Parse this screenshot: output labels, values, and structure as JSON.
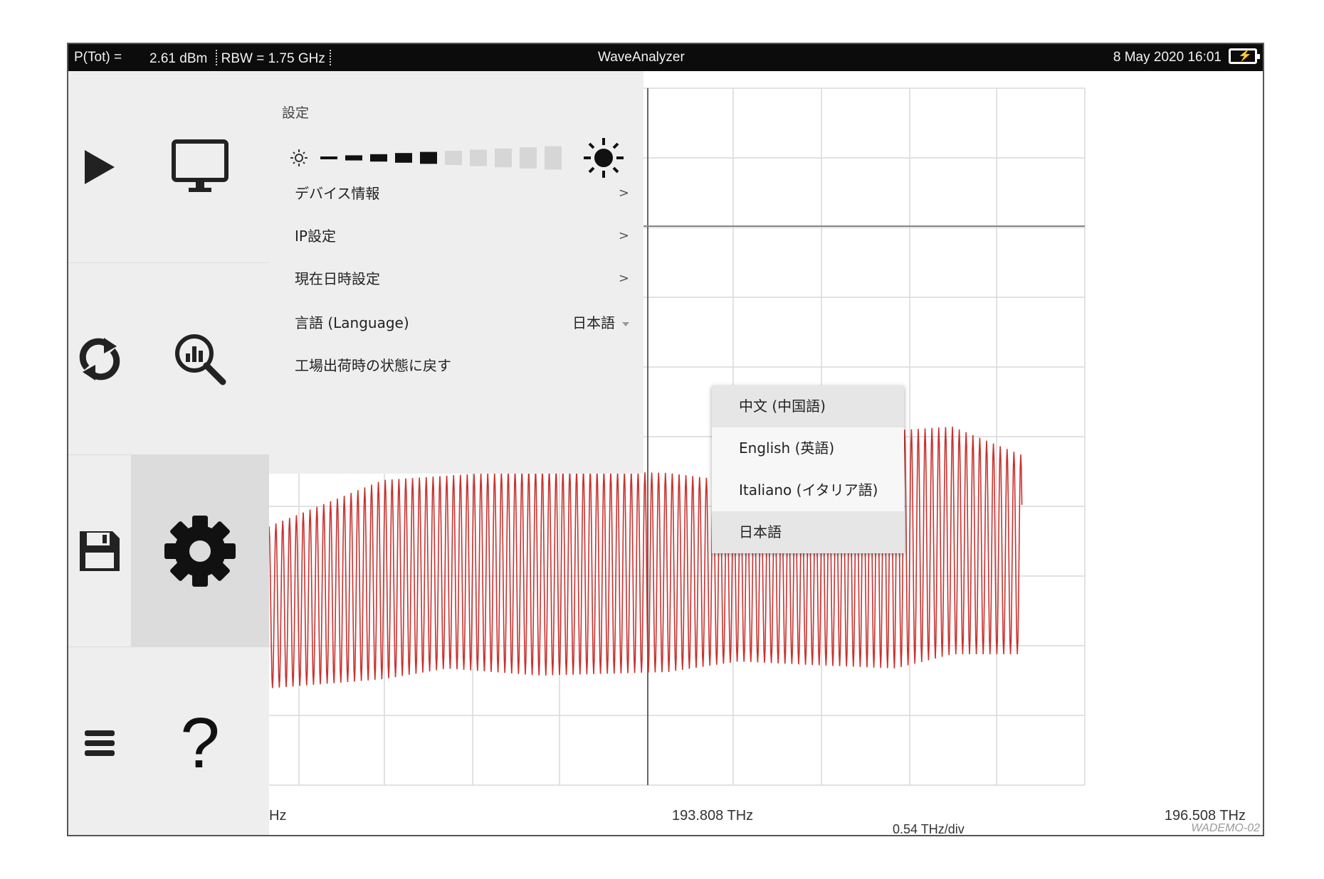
{
  "statusbar": {
    "power_label": "P(Tot) =",
    "power_value": "2.61 dBm",
    "rbw": "RBW = 1.75 GHz",
    "app_title": "WaveAnalyzer",
    "datetime": "8 May 2020 16:01"
  },
  "rail": {
    "icons": [
      "play-icon",
      "refresh-icon",
      "save-icon",
      "menu-icon",
      "monitor-icon",
      "analysis-zoom-icon",
      "gear-icon",
      "help-icon"
    ],
    "active": "gear-icon"
  },
  "settings": {
    "title": "設定",
    "brightness_level": 0.5,
    "items": [
      {
        "label": "デバイス情報",
        "chevron": ">"
      },
      {
        "label": "IP設定",
        "chevron": ">"
      },
      {
        "label": "現在日時設定",
        "chevron": ">"
      },
      {
        "label": "言語 (Language)",
        "value": "日本語"
      },
      {
        "label": "工場出荷時の状態に戻す"
      }
    ]
  },
  "language_dropdown": {
    "options": [
      "中文 (中国語)",
      "English (英語)",
      "Italiano (イタリア語)",
      "日本語"
    ],
    "highlighted": [
      "中文 (中国語)",
      "日本語"
    ]
  },
  "plot": {
    "x_labels": {
      "left_partial": "Hz",
      "center": "193.808 THz",
      "right": "196.508 THz"
    },
    "scale": "0.54 THz/div",
    "watermark": "WADEMO-02",
    "trace_color": "#c8322f",
    "grid_color": "#d9d9d9"
  },
  "chart_data": {
    "type": "line",
    "x_center_thz": 193.808,
    "x_right_thz": 196.508,
    "x_div_thz": 0.54,
    "series": [
      {
        "values_note": "",
        "color": "#c8322f"
      }
    ]
  }
}
